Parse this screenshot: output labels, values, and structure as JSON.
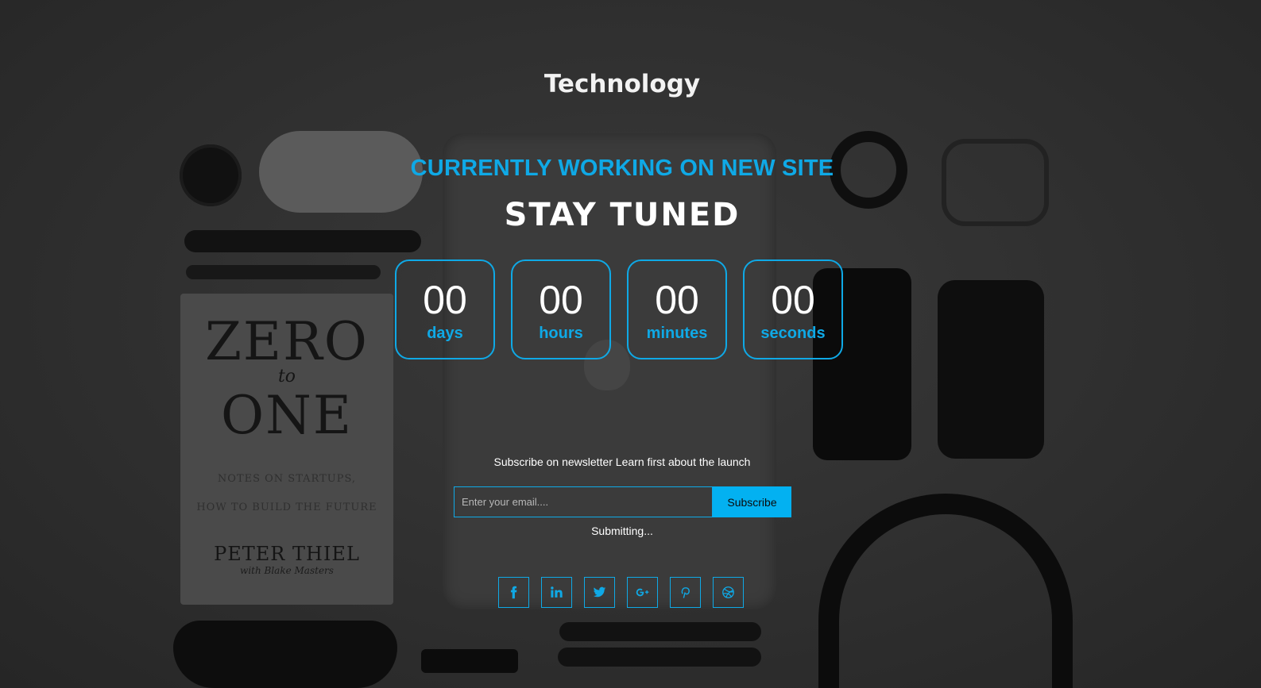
{
  "brand": {
    "title": "Technology"
  },
  "hero": {
    "subtitle": "CURRENTLY WORKING ON NEW SITE",
    "headline": "STAY TUNED"
  },
  "countdown": [
    {
      "value": "00",
      "unit": "days"
    },
    {
      "value": "00",
      "unit": "hours"
    },
    {
      "value": "00",
      "unit": "minutes"
    },
    {
      "value": "00",
      "unit": "seconds"
    }
  ],
  "newsletter": {
    "text": "Subscribe on newsletter Learn first about the launch",
    "placeholder": "Enter your email....",
    "button_label": "Subscribe",
    "status": "Submitting..."
  },
  "social": [
    {
      "icon": "facebook-icon"
    },
    {
      "icon": "linkedin-icon"
    },
    {
      "icon": "twitter-icon"
    },
    {
      "icon": "google-plus-icon"
    },
    {
      "icon": "pinterest-icon"
    },
    {
      "icon": "dribbble-icon"
    }
  ],
  "colors": {
    "accent": "#0fa9e6",
    "button": "#03b1f1",
    "text": "#ffffff"
  },
  "background_book": {
    "line1": "ZERO",
    "line2": "to",
    "line3": "ONE",
    "line4": "NOTES ON STARTUPS,",
    "line5": "HOW TO BUILD THE FUTURE",
    "author": "PETER THIEL",
    "coauthor": "with Blake Masters"
  }
}
